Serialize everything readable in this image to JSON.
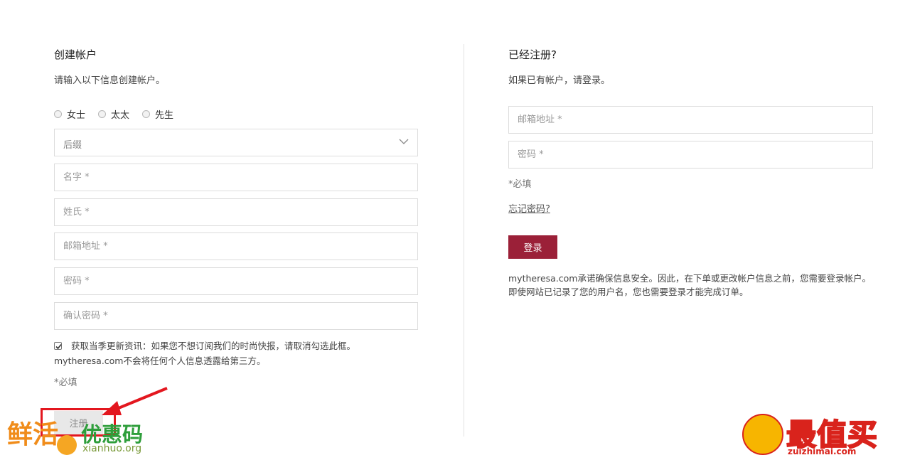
{
  "create": {
    "title": "创建帐户",
    "subtitle": "请输入以下信息创建帐户。",
    "salutations": [
      "女士",
      "太太",
      "先生"
    ],
    "suffix_select": "后缀",
    "first_name_placeholder": "名字 *",
    "last_name_placeholder": "姓氏 *",
    "email_placeholder": "邮箱地址 *",
    "password_placeholder": "密码 *",
    "confirm_password_placeholder": "确认密码 *",
    "newsletter_line1": "获取当季更新资讯：如果您不想订阅我们的时尚快报，请取消勾选此框。",
    "newsletter_line2": "mytheresa.com不会将任何个人信息透露给第三方。",
    "newsletter_checked": true,
    "required_note": "*必填",
    "register_button": "注册"
  },
  "login": {
    "title": "已经注册?",
    "subtitle": "如果已有帐户，请登录。",
    "email_placeholder": "邮箱地址 *",
    "password_placeholder": "密码 *",
    "required_note": "*必填",
    "forgot_link": "忘记密码?",
    "login_button": "登录",
    "assurance": "mytheresa.com承诺确保信息安全。因此，在下单或更改帐户信息之前，您需要登录帐户。即使网站已记录了您的用户名，您也需要登录才能完成订单。"
  },
  "watermarks": {
    "left_brand": "鲜活",
    "left_coupon": "优惠码",
    "left_url": "xianhuo.org",
    "right_brand": "最值买",
    "right_url": "zuizhimai.com"
  },
  "colors": {
    "login_button": "#9b2038",
    "highlight": "#e3171f"
  }
}
